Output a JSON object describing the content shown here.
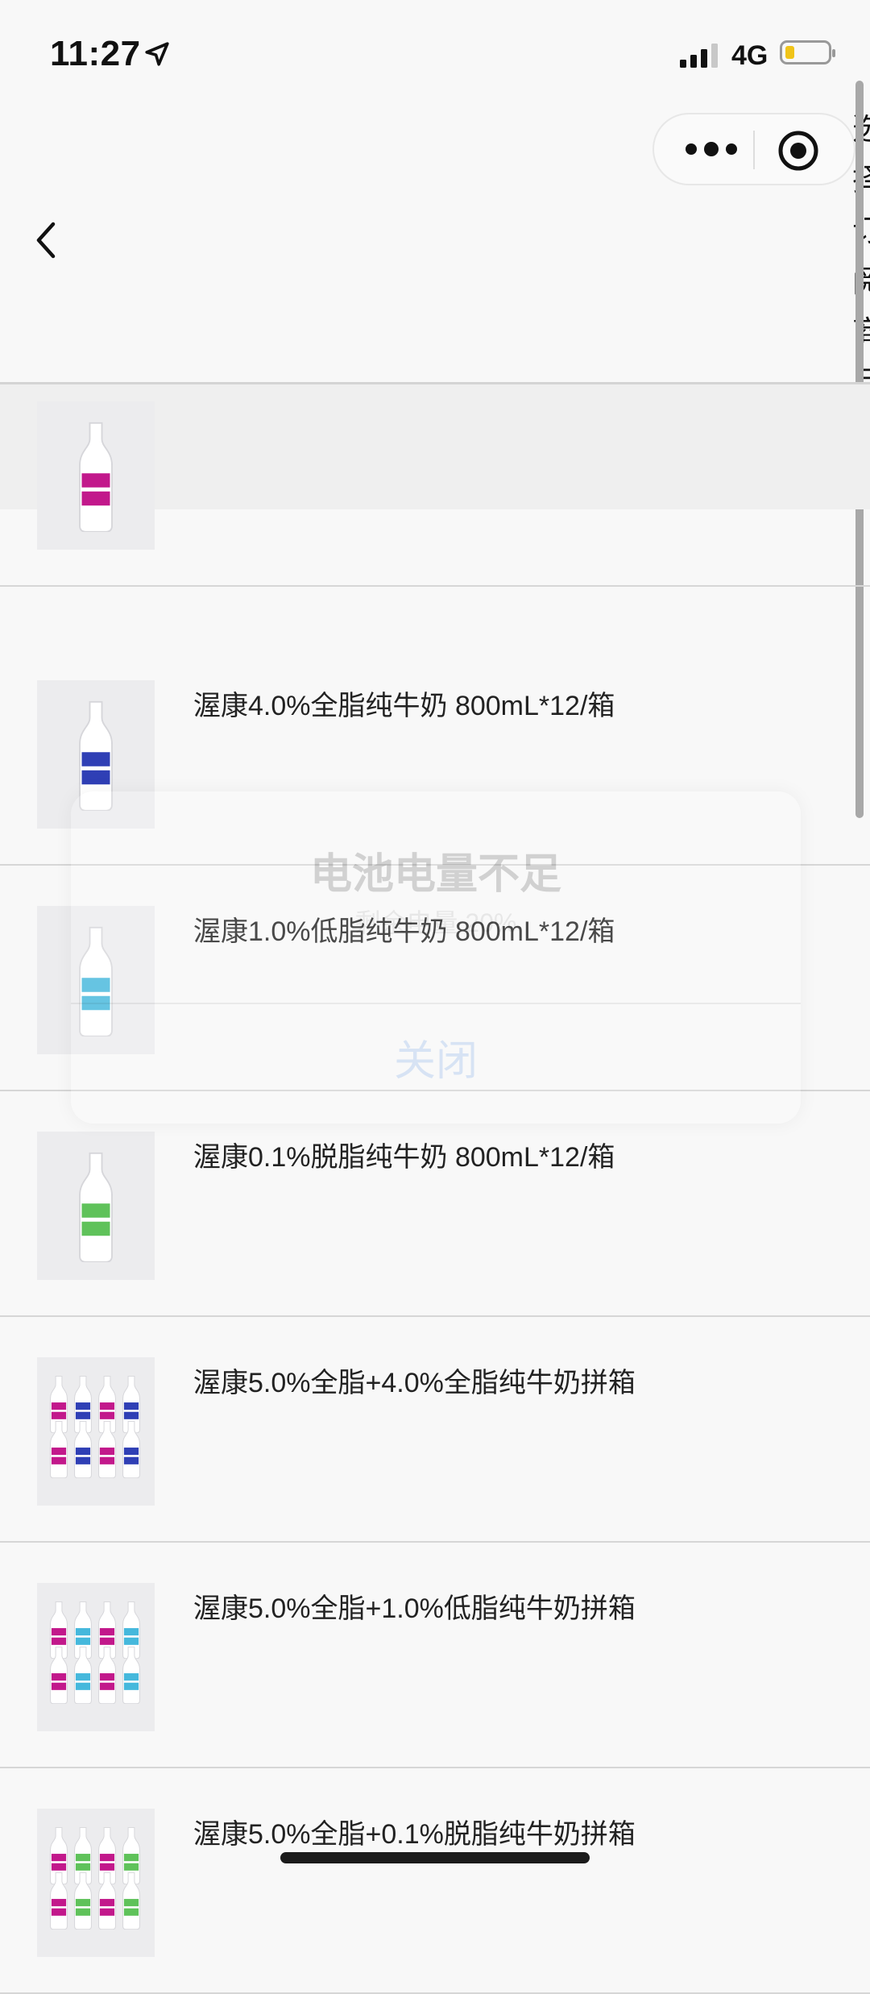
{
  "status_bar": {
    "time": "11:27",
    "network": "4G",
    "battery_level": 0.22,
    "battery_color": "#f0c419"
  },
  "nav": {
    "side_title": "选择订阅商品"
  },
  "toast": {
    "title": "电池电量不足",
    "subtitle": "剩余电量 20%",
    "close_label": "关闭"
  },
  "products": [
    {
      "name": "",
      "thumb_color": "#c2188b",
      "thumb_count": 1
    },
    {
      "name": "渥康4.0%全脂纯牛奶 800mL*12/箱",
      "thumb_color": "#2f3fb5",
      "thumb_count": 1
    },
    {
      "name": "渥康1.0%低脂纯牛奶 800mL*12/箱",
      "thumb_color": "#45b8dc",
      "thumb_count": 1
    },
    {
      "name": "渥康0.1%脱脂纯牛奶 800mL*12/箱",
      "thumb_color": "#5fc25a",
      "thumb_count": 1
    },
    {
      "name": "渥康5.0%全脂+4.0%全脂纯牛奶拼箱",
      "thumb_color": "#c2188b",
      "thumb_color_2": "#2f3fb5",
      "thumb_count": 8
    },
    {
      "name": "渥康5.0%全脂+1.0%低脂纯牛奶拼箱",
      "thumb_color": "#c2188b",
      "thumb_color_2": "#45b8dc",
      "thumb_count": 8
    },
    {
      "name": "渥康5.0%全脂+0.1%脱脂纯牛奶拼箱",
      "thumb_color": "#c2188b",
      "thumb_color_2": "#5fc25a",
      "thumb_count": 8
    }
  ]
}
